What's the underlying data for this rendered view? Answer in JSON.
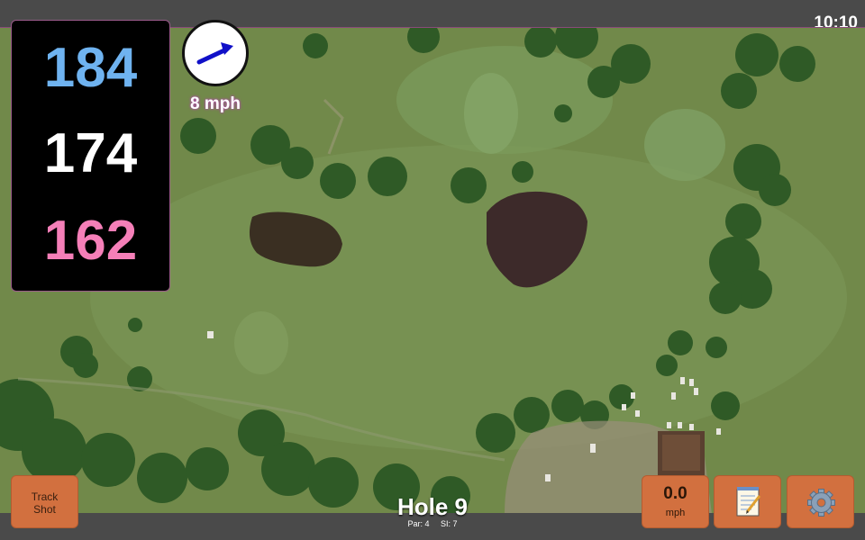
{
  "status": {
    "time": "10:10"
  },
  "distances": {
    "back": "184",
    "center": "174",
    "front": "162"
  },
  "wind": {
    "speed": "8 mph",
    "icon": "wind-arrow-icon"
  },
  "hole": {
    "title": "Hole 9",
    "par": "Par: 4",
    "si": "SI: 7"
  },
  "buttons": {
    "track_line1": "Track",
    "track_line2": "Shot",
    "speed_value": "0.0",
    "speed_unit": "mph",
    "notes_icon": "notepad-icon",
    "settings_icon": "gear-icon"
  },
  "colors": {
    "back": "#6fb3f0",
    "center": "#ffffff",
    "front": "#f57fb8",
    "button": "#d2703f"
  }
}
